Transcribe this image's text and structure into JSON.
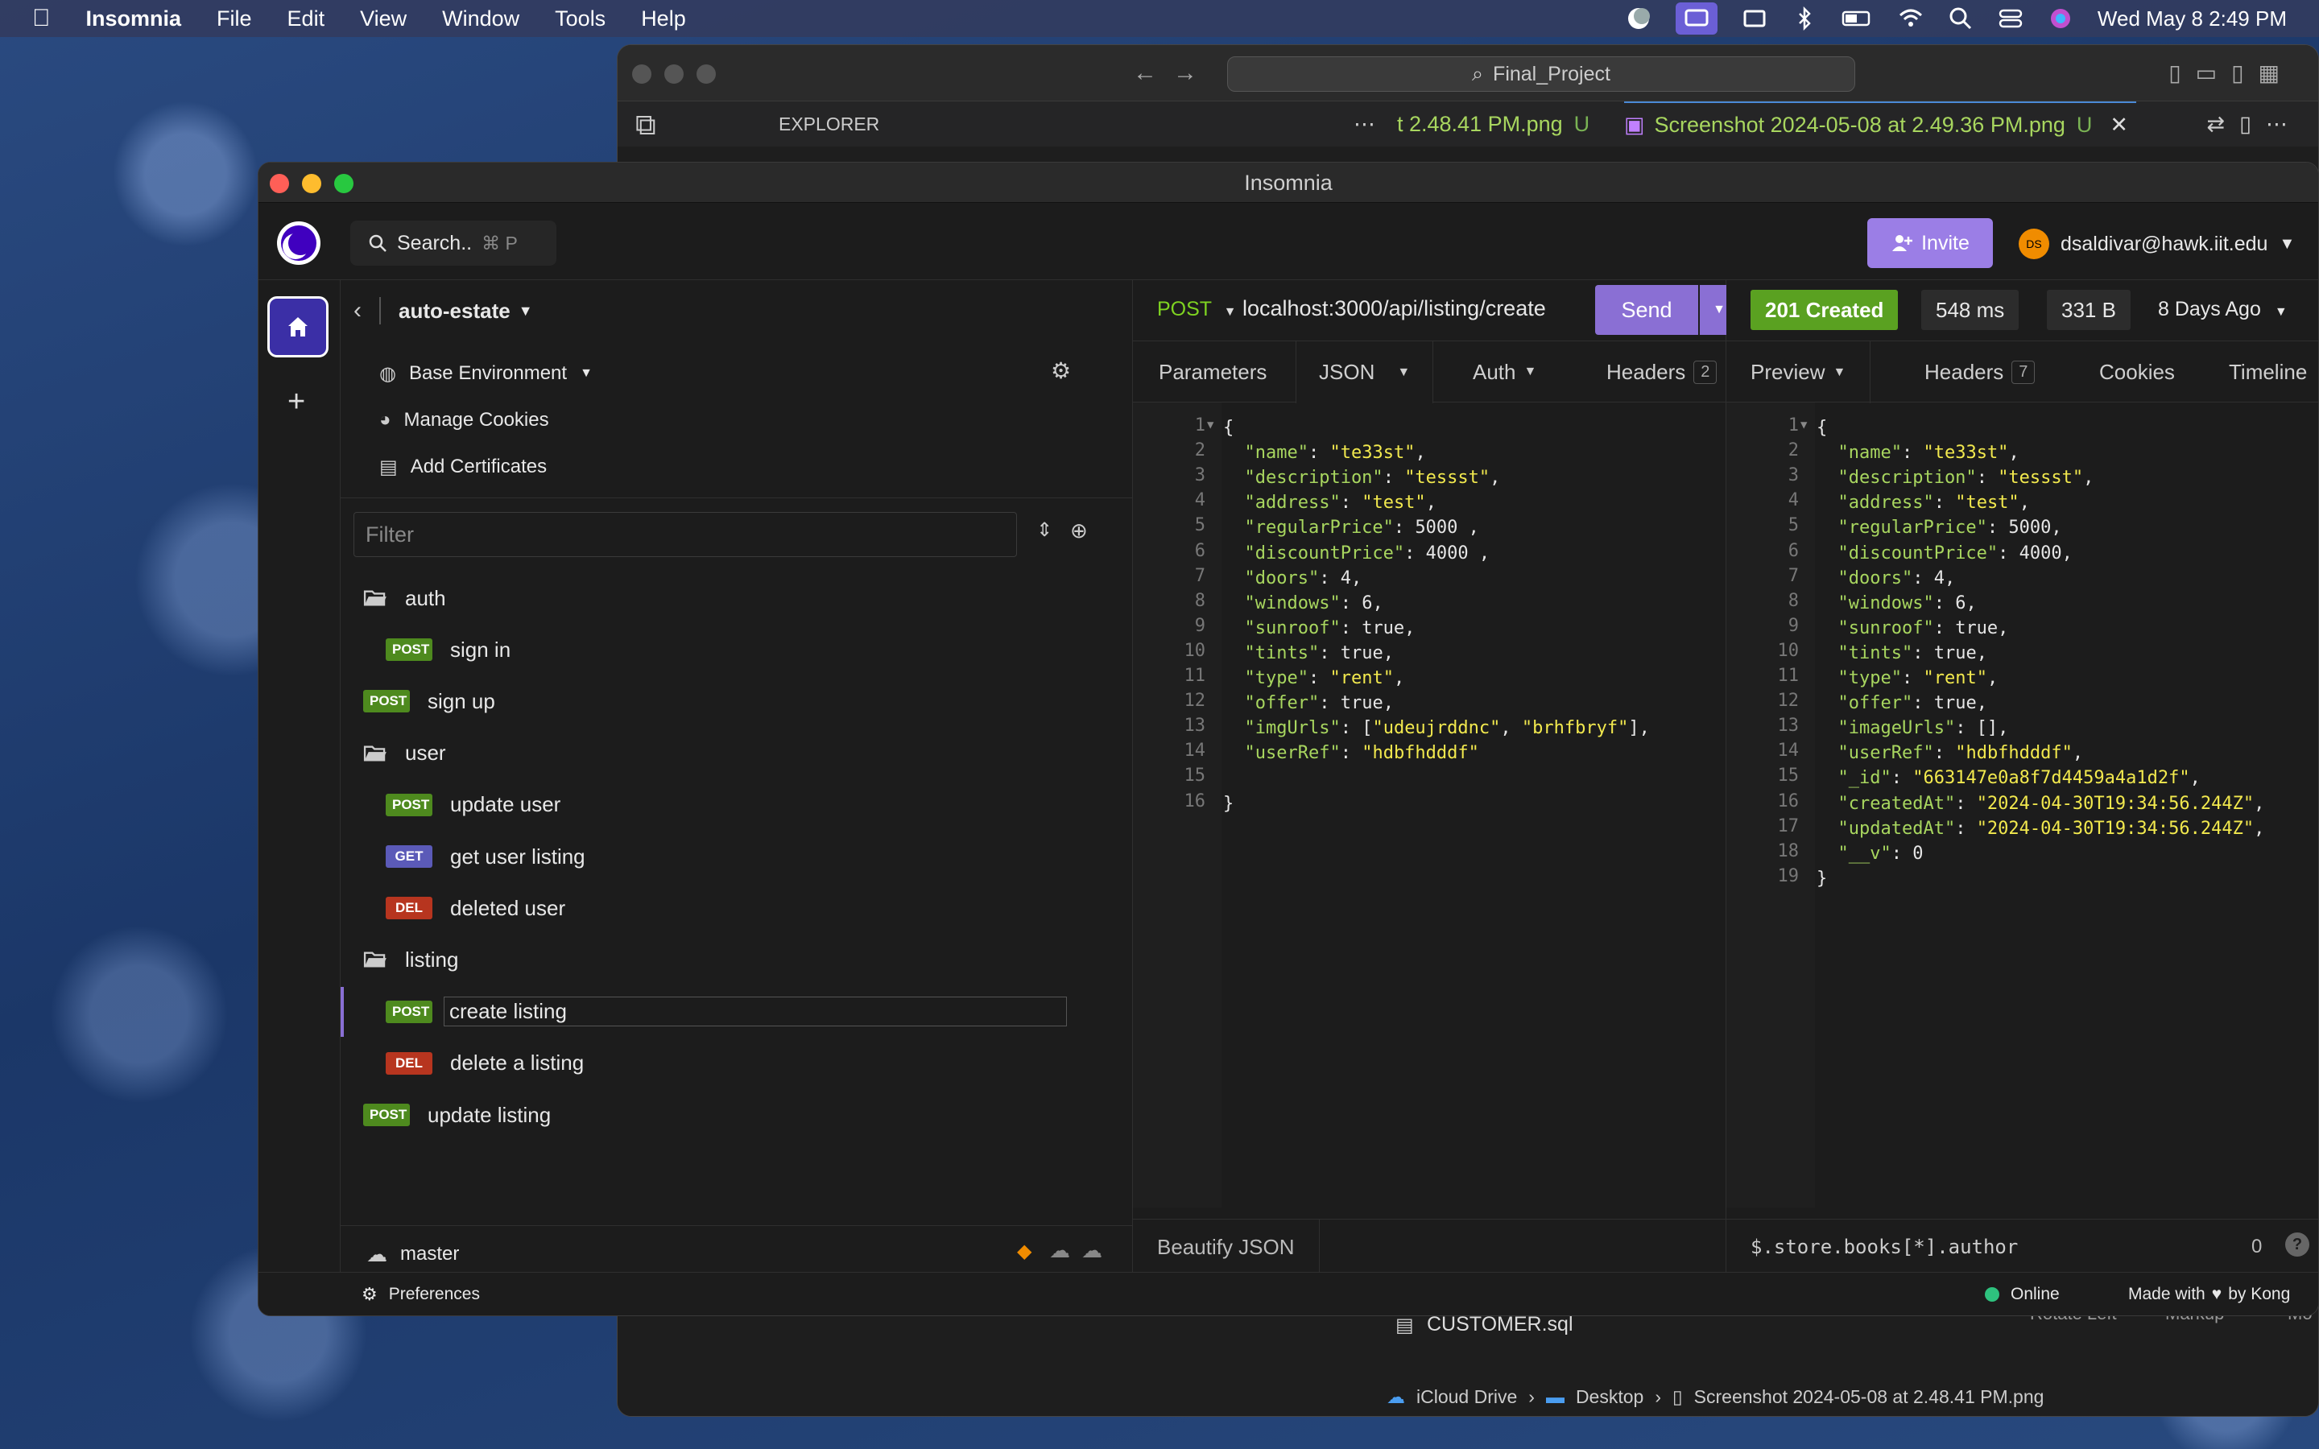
{
  "menubar": {
    "app": "Insomnia",
    "items": [
      "File",
      "Edit",
      "View",
      "Window",
      "Tools",
      "Help"
    ],
    "clock": "Wed May 8  2:49 PM"
  },
  "vscode": {
    "search": "Final_Project",
    "explorer_label": "EXPLORER",
    "tab1": "t 2.48.41 PM.png",
    "tab1_status": "U",
    "tab2": "Screenshot 2024-05-08 at 2.49.36 PM.png",
    "tab2_status": "U",
    "file_item": "CUSTOMER.sql",
    "bottom_right_1": "Rotate Left",
    "bottom_right_2": "Markup",
    "bottom_right_3": "Mo",
    "breadcrumb": [
      "iCloud Drive",
      "Desktop",
      "Screenshot 2024-05-08 at 2.48.41 PM.png"
    ]
  },
  "insomnia": {
    "title": "Insomnia",
    "search_label": "Search..",
    "search_shortcut": "⌘ P",
    "invite": "Invite",
    "user_initials": "DS",
    "user_email": "dsaldivar@hawk.iit.edu",
    "project": "auto-estate",
    "env": "Base Environment",
    "manage_cookies": "Manage Cookies",
    "add_certificates": "Add Certificates",
    "filter_placeholder": "Filter",
    "tree": [
      {
        "type": "folder",
        "label": "auth",
        "indent": 0
      },
      {
        "type": "req",
        "method": "POST",
        "label": "sign in",
        "indent": 1
      },
      {
        "type": "req",
        "method": "POST",
        "label": "sign up",
        "indent": 0
      },
      {
        "type": "folder",
        "label": "user",
        "indent": 0
      },
      {
        "type": "req",
        "method": "POST",
        "label": "update user",
        "indent": 1
      },
      {
        "type": "req",
        "method": "GET",
        "label": "get user listing",
        "indent": 1
      },
      {
        "type": "req",
        "method": "DEL",
        "label": "deleted user",
        "indent": 1
      },
      {
        "type": "folder",
        "label": "listing",
        "indent": 0
      },
      {
        "type": "req",
        "method": "POST",
        "label": "create listing",
        "indent": 1,
        "selected": true
      },
      {
        "type": "req",
        "method": "DEL",
        "label": "delete a listing",
        "indent": 1
      },
      {
        "type": "req",
        "method": "POST",
        "label": "update listing",
        "indent": 0
      }
    ],
    "branch": "master",
    "preferences": "Preferences",
    "online": "Online",
    "made_with": "Made with",
    "by_kong": "by Kong",
    "request": {
      "method": "POST",
      "url": "localhost:3000/api/listing/create",
      "send": "Send",
      "tabs": {
        "params": "Parameters",
        "body": "JSON",
        "auth": "Auth",
        "headers": "Headers",
        "headers_count": "2"
      },
      "footer": "Beautify JSON",
      "lines": [
        [
          {
            "t": "p",
            "v": "{"
          }
        ],
        [
          {
            "t": "k",
            "v": "  \"name\""
          },
          {
            "t": "p",
            "v": ": "
          },
          {
            "t": "s",
            "v": "\"te33st\""
          },
          {
            "t": "p",
            "v": ","
          }
        ],
        [
          {
            "t": "k",
            "v": "  \"description\""
          },
          {
            "t": "p",
            "v": ": "
          },
          {
            "t": "s",
            "v": "\"tessst\""
          },
          {
            "t": "p",
            "v": ","
          }
        ],
        [
          {
            "t": "k",
            "v": "  \"address\""
          },
          {
            "t": "p",
            "v": ": "
          },
          {
            "t": "s",
            "v": "\"test\""
          },
          {
            "t": "p",
            "v": ","
          }
        ],
        [
          {
            "t": "k",
            "v": "  \"regularPrice\""
          },
          {
            "t": "p",
            "v": ": 5000 ,"
          }
        ],
        [
          {
            "t": "k",
            "v": "  \"discountPrice\""
          },
          {
            "t": "p",
            "v": ": 4000 ,"
          }
        ],
        [
          {
            "t": "k",
            "v": "  \"doors\""
          },
          {
            "t": "p",
            "v": ": 4,"
          }
        ],
        [
          {
            "t": "k",
            "v": "  \"windows\""
          },
          {
            "t": "p",
            "v": ": 6,"
          }
        ],
        [
          {
            "t": "k",
            "v": "  \"sunroof\""
          },
          {
            "t": "p",
            "v": ": true,"
          }
        ],
        [
          {
            "t": "k",
            "v": "  \"tints\""
          },
          {
            "t": "p",
            "v": ": true,"
          }
        ],
        [
          {
            "t": "k",
            "v": "  \"type\""
          },
          {
            "t": "p",
            "v": ": "
          },
          {
            "t": "s",
            "v": "\"rent\""
          },
          {
            "t": "p",
            "v": ","
          }
        ],
        [
          {
            "t": "k",
            "v": "  \"offer\""
          },
          {
            "t": "p",
            "v": ": true,"
          }
        ],
        [
          {
            "t": "k",
            "v": "  \"imgUrls\""
          },
          {
            "t": "p",
            "v": ": ["
          },
          {
            "t": "s",
            "v": "\"udeujrddnc\""
          },
          {
            "t": "p",
            "v": ", "
          },
          {
            "t": "s",
            "v": "\"brhfbryf\""
          },
          {
            "t": "p",
            "v": "],"
          }
        ],
        [
          {
            "t": "k",
            "v": "  \"userRef\""
          },
          {
            "t": "p",
            "v": ": "
          },
          {
            "t": "s",
            "v": "\"hdbfhdddf\""
          }
        ],
        [
          {
            "t": "p",
            "v": ""
          }
        ],
        [
          {
            "t": "p",
            "v": "}"
          }
        ]
      ]
    },
    "response": {
      "status": "201 Created",
      "time": "548 ms",
      "size": "331 B",
      "age": "8 Days Ago",
      "tabs": {
        "preview": "Preview",
        "headers": "Headers",
        "headers_count": "7",
        "cookies": "Cookies",
        "timeline": "Timeline"
      },
      "filter_query": "$.store.books[*].author",
      "filter_count": "0",
      "lines": [
        [
          {
            "t": "p",
            "v": "{"
          }
        ],
        [
          {
            "t": "k",
            "v": "  \"name\""
          },
          {
            "t": "p",
            "v": ": "
          },
          {
            "t": "s",
            "v": "\"te33st\""
          },
          {
            "t": "p",
            "v": ","
          }
        ],
        [
          {
            "t": "k",
            "v": "  \"description\""
          },
          {
            "t": "p",
            "v": ": "
          },
          {
            "t": "s",
            "v": "\"tessst\""
          },
          {
            "t": "p",
            "v": ","
          }
        ],
        [
          {
            "t": "k",
            "v": "  \"address\""
          },
          {
            "t": "p",
            "v": ": "
          },
          {
            "t": "s",
            "v": "\"test\""
          },
          {
            "t": "p",
            "v": ","
          }
        ],
        [
          {
            "t": "k",
            "v": "  \"regularPrice\""
          },
          {
            "t": "p",
            "v": ": 5000,"
          }
        ],
        [
          {
            "t": "k",
            "v": "  \"discountPrice\""
          },
          {
            "t": "p",
            "v": ": 4000,"
          }
        ],
        [
          {
            "t": "k",
            "v": "  \"doors\""
          },
          {
            "t": "p",
            "v": ": 4,"
          }
        ],
        [
          {
            "t": "k",
            "v": "  \"windows\""
          },
          {
            "t": "p",
            "v": ": 6,"
          }
        ],
        [
          {
            "t": "k",
            "v": "  \"sunroof\""
          },
          {
            "t": "p",
            "v": ": true,"
          }
        ],
        [
          {
            "t": "k",
            "v": "  \"tints\""
          },
          {
            "t": "p",
            "v": ": true,"
          }
        ],
        [
          {
            "t": "k",
            "v": "  \"type\""
          },
          {
            "t": "p",
            "v": ": "
          },
          {
            "t": "s",
            "v": "\"rent\""
          },
          {
            "t": "p",
            "v": ","
          }
        ],
        [
          {
            "t": "k",
            "v": "  \"offer\""
          },
          {
            "t": "p",
            "v": ": true,"
          }
        ],
        [
          {
            "t": "k",
            "v": "  \"imageUrls\""
          },
          {
            "t": "p",
            "v": ": [],"
          }
        ],
        [
          {
            "t": "k",
            "v": "  \"userRef\""
          },
          {
            "t": "p",
            "v": ": "
          },
          {
            "t": "s",
            "v": "\"hdbfhdddf\""
          },
          {
            "t": "p",
            "v": ","
          }
        ],
        [
          {
            "t": "k",
            "v": "  \"_id\""
          },
          {
            "t": "p",
            "v": ": "
          },
          {
            "t": "s",
            "v": "\"663147e0a8f7d4459a4a1d2f\""
          },
          {
            "t": "p",
            "v": ","
          }
        ],
        [
          {
            "t": "k",
            "v": "  \"createdAt\""
          },
          {
            "t": "p",
            "v": ": "
          },
          {
            "t": "s",
            "v": "\"2024-04-30T19:34:56.244Z\""
          },
          {
            "t": "p",
            "v": ","
          }
        ],
        [
          {
            "t": "k",
            "v": "  \"updatedAt\""
          },
          {
            "t": "p",
            "v": ": "
          },
          {
            "t": "s",
            "v": "\"2024-04-30T19:34:56.244Z\""
          },
          {
            "t": "p",
            "v": ","
          }
        ],
        [
          {
            "t": "k",
            "v": "  \"__v\""
          },
          {
            "t": "p",
            "v": ": 0"
          }
        ],
        [
          {
            "t": "p",
            "v": "}"
          }
        ]
      ]
    }
  },
  "colors": {
    "accent": "#9b7ee6",
    "status_ok": "#5aa121",
    "post": "#4e8a1e",
    "get": "#5b5ab8",
    "del": "#b7351f"
  }
}
